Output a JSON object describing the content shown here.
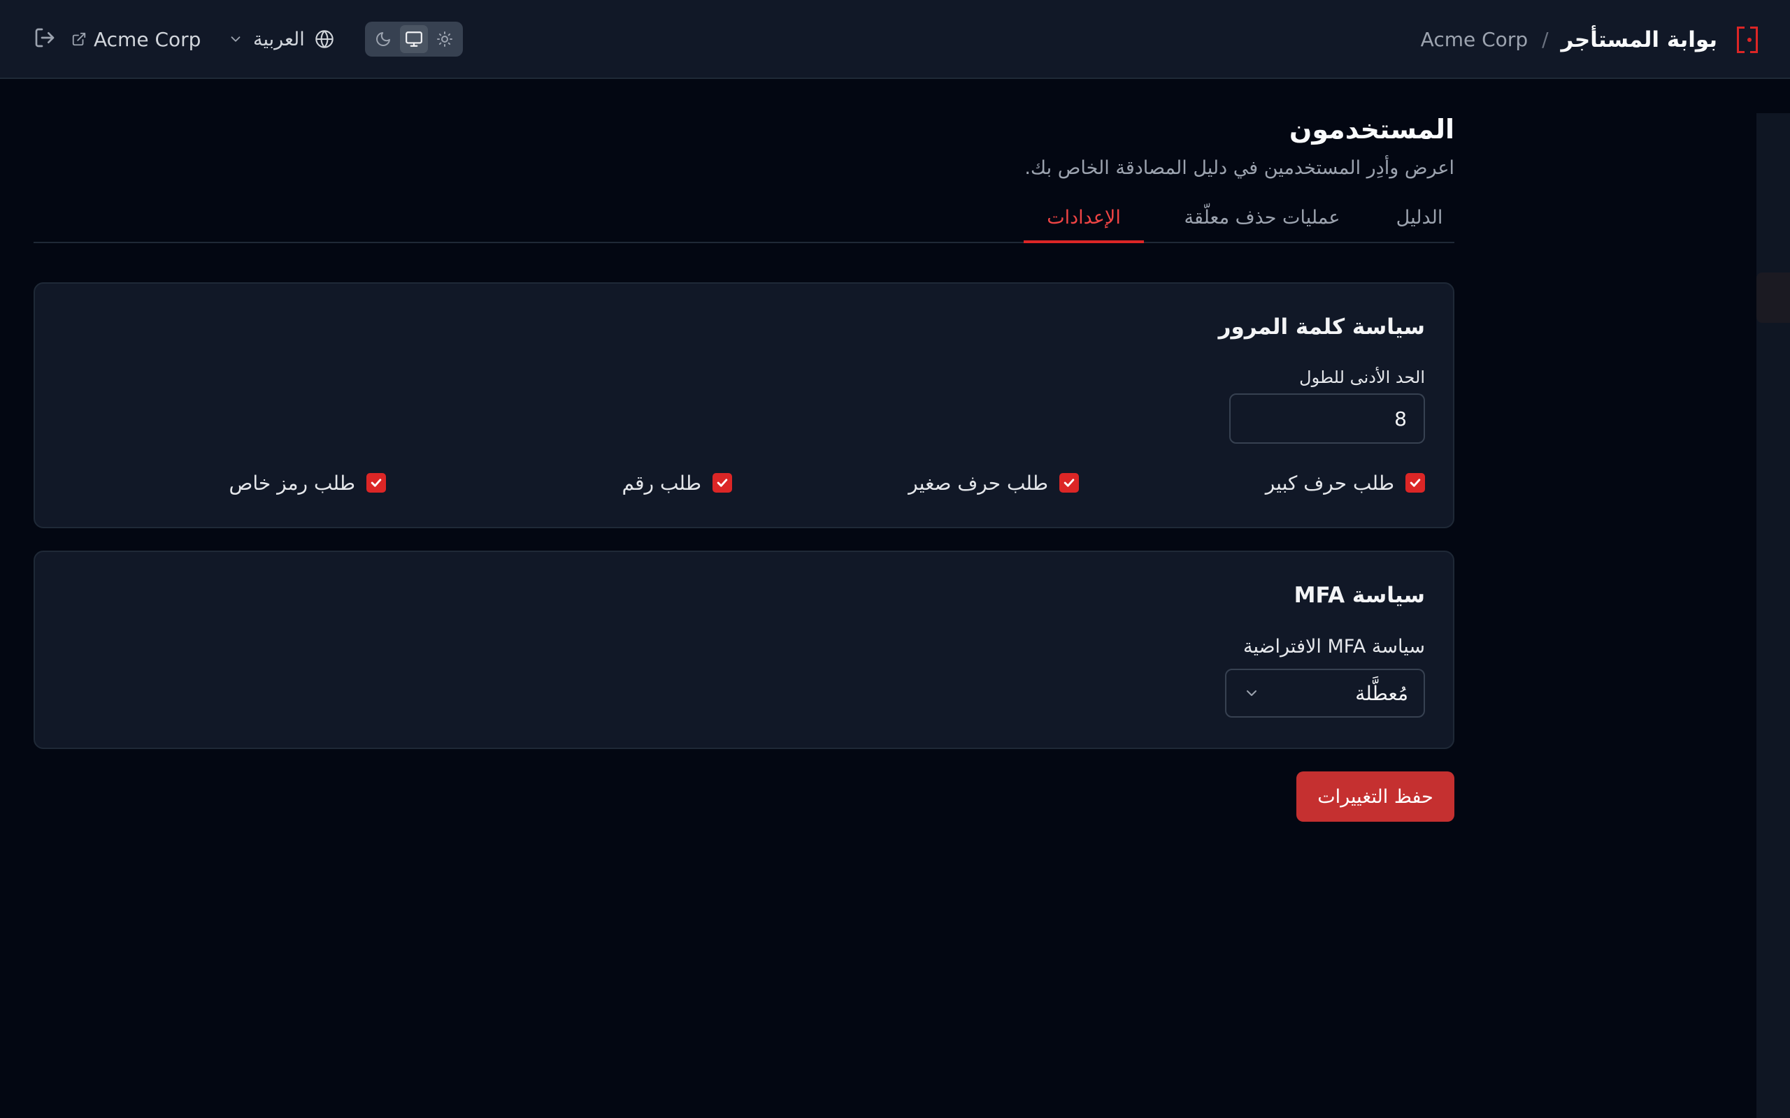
{
  "header": {
    "title": "بوابة المستأجر",
    "separator": "/",
    "tenant": "Acme Corp",
    "tenant_link": "Acme Corp",
    "language": "العربية",
    "theme_options": [
      "moon-icon",
      "monitor-icon",
      "sun-icon"
    ],
    "theme_selected": "monitor-icon",
    "brand_color": "#dc2626"
  },
  "page": {
    "title": "المستخدمون",
    "subtitle": "اعرض وأدِر المستخدمين في دليل المصادقة الخاص بك."
  },
  "tabs": [
    {
      "label": "الدليل",
      "active": false
    },
    {
      "label": "عمليات حذف معلّقة",
      "active": false
    },
    {
      "label": "الإعدادات",
      "active": true
    }
  ],
  "password_policy": {
    "title": "سياسة كلمة المرور",
    "min_length_label": "الحد الأدنى للطول",
    "min_length_value": "8",
    "options": [
      {
        "label": "طلب حرف كبير",
        "checked": true
      },
      {
        "label": "طلب حرف صغير",
        "checked": true
      },
      {
        "label": "طلب رقم",
        "checked": true
      },
      {
        "label": "طلب رمز خاص",
        "checked": true
      }
    ]
  },
  "mfa_policy": {
    "title": "سياسة MFA",
    "default_label": "سياسة MFA الافتراضية",
    "default_value": "مُعطَّلة"
  },
  "actions": {
    "save_label": "حفظ التغييرات"
  }
}
